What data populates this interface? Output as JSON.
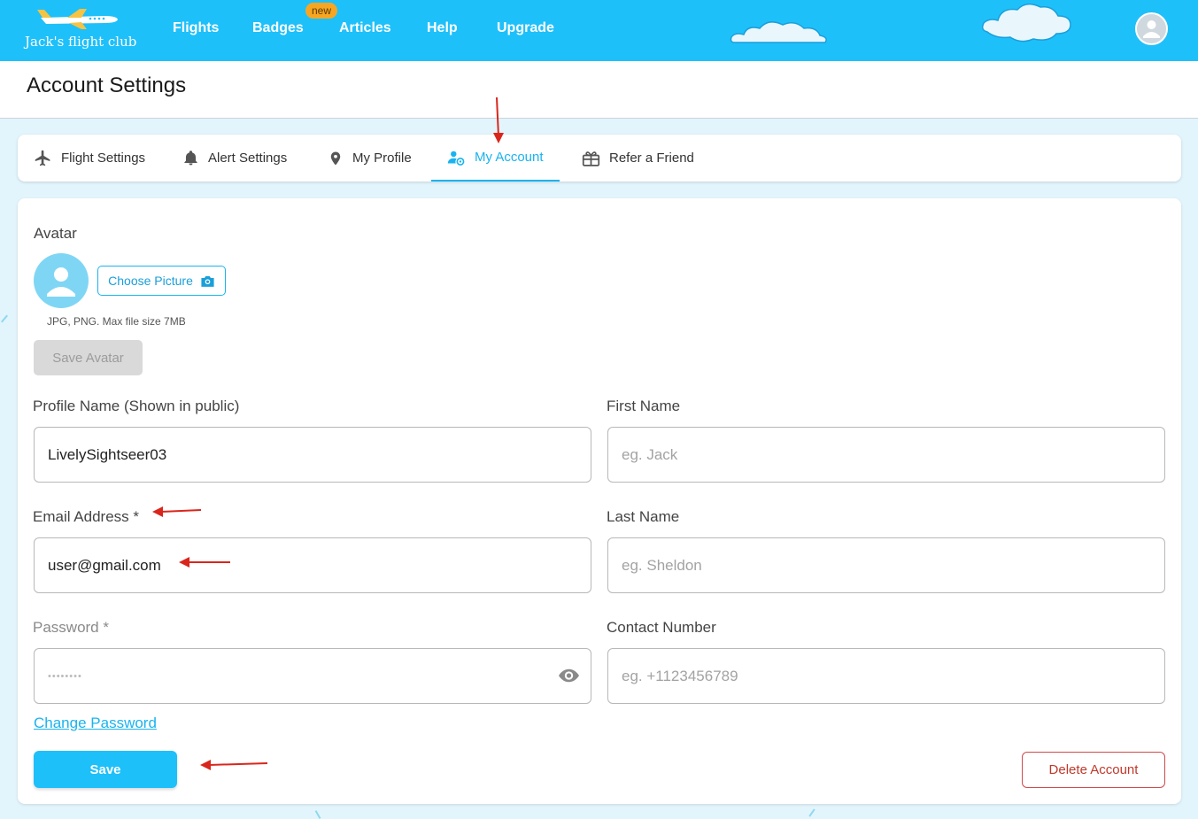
{
  "brand": {
    "name": "Jack's flight club"
  },
  "nav": {
    "flights": "Flights",
    "badges": "Badges",
    "new_badge": "new",
    "articles": "Articles",
    "help": "Help",
    "upgrade": "Upgrade"
  },
  "page": {
    "title": "Account Settings"
  },
  "tabs": [
    {
      "label": "Flight Settings",
      "icon": "airplane-icon"
    },
    {
      "label": "Alert Settings",
      "icon": "bell-icon"
    },
    {
      "label": "My Profile",
      "icon": "location-pin-icon"
    },
    {
      "label": "My Account",
      "icon": "user-gear-icon",
      "active": true
    },
    {
      "label": "Refer a Friend",
      "icon": "gift-icon"
    }
  ],
  "avatar": {
    "label": "Avatar",
    "choose_label": "Choose Picture",
    "hint": "JPG, PNG. Max file size 7MB",
    "save_label": "Save Avatar"
  },
  "form": {
    "profile_name": {
      "label": "Profile Name (Shown in public)",
      "value": "LivelySightseer03"
    },
    "first_name": {
      "label": "First Name",
      "placeholder": "eg. Jack"
    },
    "email": {
      "label": "Email Address *",
      "value": "user@gmail.com"
    },
    "last_name": {
      "label": "Last Name",
      "placeholder": "eg. Sheldon"
    },
    "password": {
      "label": "Password *",
      "value": "••••••••"
    },
    "contact_number": {
      "label": "Contact Number",
      "placeholder": "eg. +1123456789"
    }
  },
  "actions": {
    "change_password": "Change Password",
    "save": "Save",
    "delete_account": "Delete Account"
  },
  "colors": {
    "brand_blue": "#1ec0fa",
    "accent": "#1ab3ef",
    "danger": "#c0392b",
    "annotation_arrow": "#d9261c"
  }
}
